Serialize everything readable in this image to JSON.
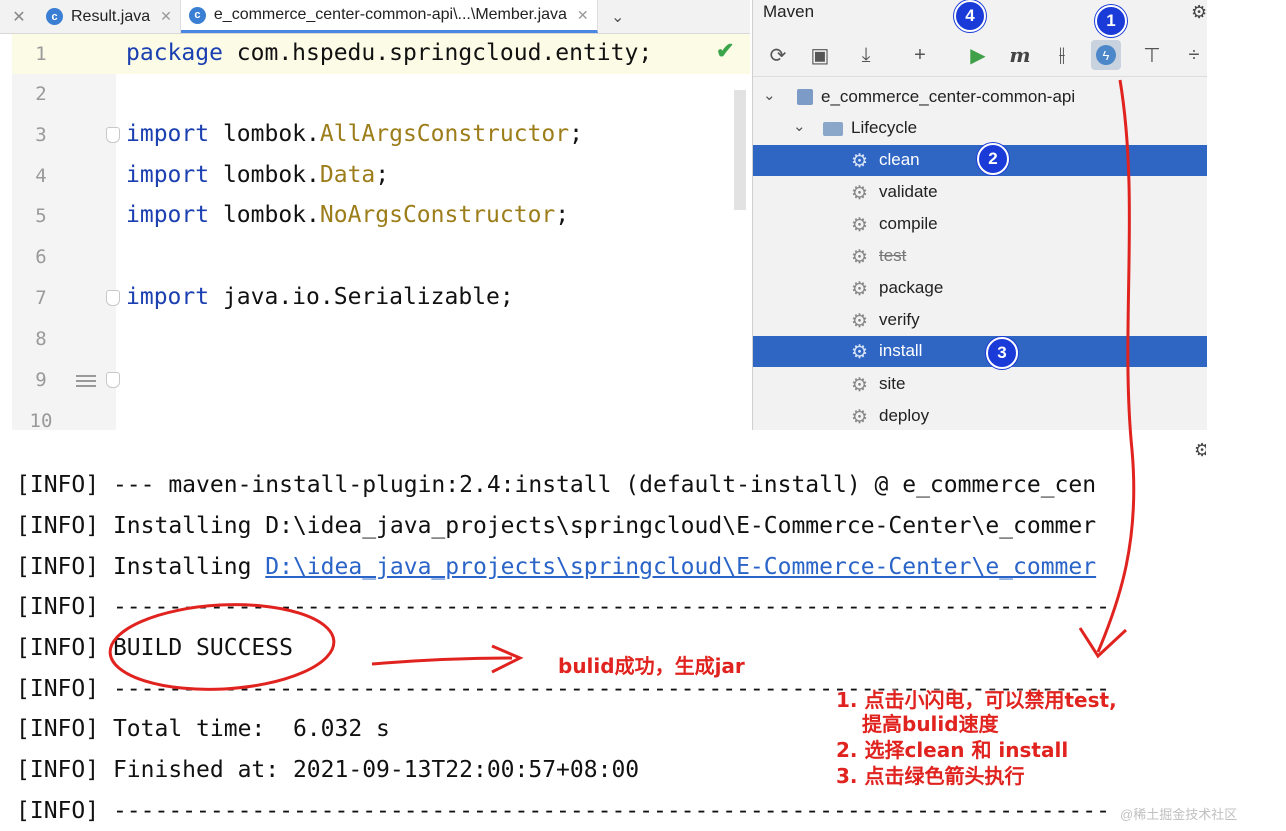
{
  "tabs": [
    {
      "label": "Result.java",
      "active": false
    },
    {
      "label": "e_commerce_center-common-api\\...\\Member.java",
      "active": true
    }
  ],
  "editor": {
    "lines": [
      {
        "num": "1",
        "kw": "package",
        "rest": " com.hspedu.springcloud.entity;"
      },
      {
        "num": "2"
      },
      {
        "num": "3",
        "kw": "import",
        "pkg": " lombok.",
        "cls": "AllArgsConstructor",
        "end": ";"
      },
      {
        "num": "4",
        "kw": "import",
        "pkg": " lombok.",
        "cls": "Data",
        "end": ";"
      },
      {
        "num": "5",
        "kw": "import",
        "pkg": " lombok.",
        "cls": "NoArgsConstructor",
        "end": ";"
      },
      {
        "num": "6"
      },
      {
        "num": "7",
        "kw": "import",
        "rest": " java.io.Serializable;"
      },
      {
        "num": "8"
      },
      {
        "num": "9"
      },
      {
        "num": "10"
      }
    ]
  },
  "maven": {
    "title": "Maven",
    "project": "e_commerce_center-common-api",
    "lifecycle": "Lifecycle",
    "goals": [
      "clean",
      "validate",
      "compile",
      "test",
      "package",
      "verify",
      "install",
      "site",
      "deploy"
    ],
    "selected": [
      "clean",
      "install"
    ],
    "skipped": [
      "test"
    ]
  },
  "console": {
    "lines": [
      {
        "prefix": "[INFO]",
        "text": " --- maven-install-plugin:2.4:install (default-install) @ e_commerce_cen"
      },
      {
        "prefix": "[INFO]",
        "text": " Installing D:\\idea_java_projects\\springcloud\\E-Commerce-Center\\e_commer"
      },
      {
        "prefix": "[INFO]",
        "text": " Installing ",
        "link": "D:\\idea_java_projects\\springcloud\\E-Commerce-Center\\e_commer"
      },
      {
        "prefix": "[INFO]",
        "text": " ------------------------------------------------------------------------"
      },
      {
        "prefix": "[INFO]",
        "text": " BUILD SUCCESS"
      },
      {
        "prefix": "[INFO]",
        "text": " ------------------------------------------------------------------------"
      },
      {
        "prefix": "[INFO]",
        "text": " Total time:  6.032 s"
      },
      {
        "prefix": "[INFO]",
        "text": " Finished at: 2021-09-13T22:00:57+08:00"
      },
      {
        "prefix": "[INFO]",
        "text": " ------------------------------------------------------------------------"
      }
    ]
  },
  "annotations": {
    "badges": [
      "1",
      "2",
      "3",
      "4"
    ],
    "build_note": "bulid成功，生成jar",
    "steps": [
      "1. 点击小闪电，可以禁用test,",
      "提高bulid速度",
      "2. 选择clean 和 install",
      "3. 点击绿色箭头执行"
    ]
  },
  "watermark": "@稀土掘金技术社区",
  "colors": {
    "selection": "#2f66c4",
    "badge": "#1a3bd8",
    "annotation": "#e0231f",
    "keyword": "#1a3fb0"
  }
}
